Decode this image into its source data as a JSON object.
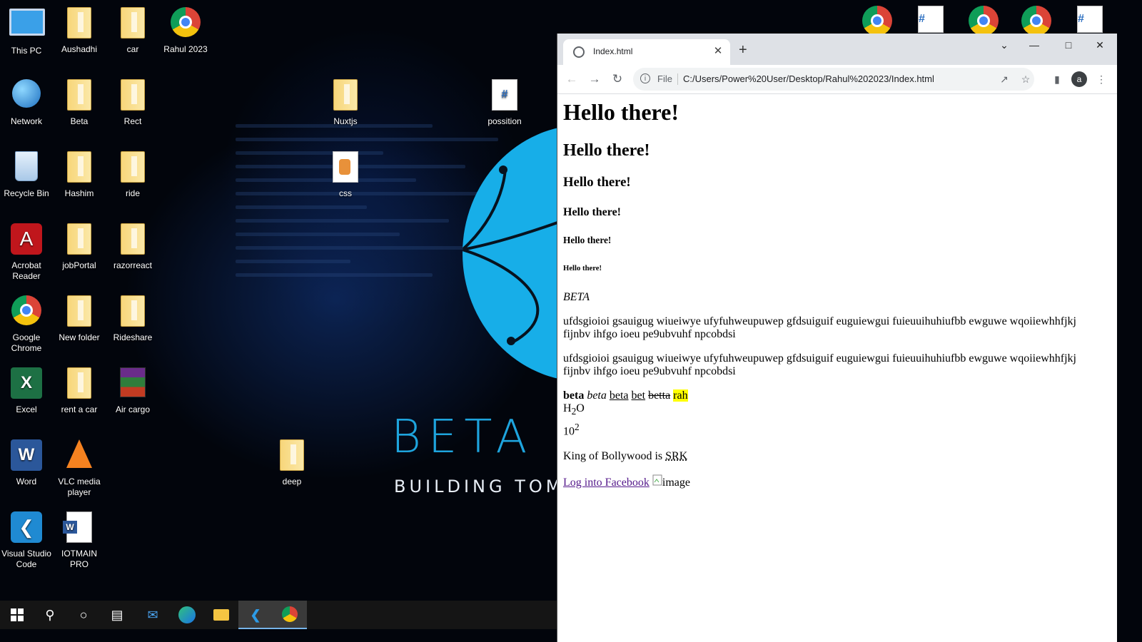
{
  "desktop": {
    "icons": [
      {
        "label": "This PC"
      },
      {
        "label": "Aushadhi"
      },
      {
        "label": "car"
      },
      {
        "label": "Rahul 2023"
      },
      {
        "label": "Network"
      },
      {
        "label": "Beta"
      },
      {
        "label": "Rect"
      },
      {
        "label": "Nuxtjs"
      },
      {
        "label": "possition"
      },
      {
        "label": "Recycle Bin"
      },
      {
        "label": "Hashim"
      },
      {
        "label": "ride"
      },
      {
        "label": "css"
      },
      {
        "label": "Acrobat Reader"
      },
      {
        "label": "jobPortal"
      },
      {
        "label": "razorreact"
      },
      {
        "label": "Google Chrome"
      },
      {
        "label": "New folder"
      },
      {
        "label": "Rideshare"
      },
      {
        "label": "Excel"
      },
      {
        "label": "rent a car"
      },
      {
        "label": "Air cargo"
      },
      {
        "label": "Word"
      },
      {
        "label": "VLC media player"
      },
      {
        "label": "deep"
      },
      {
        "label": "Visual Studio Code"
      },
      {
        "label": "IOTMAIN PRO"
      }
    ],
    "wallpaper": {
      "headline": "BETA IN",
      "tagline": "BUILDING TOMORROV"
    }
  },
  "taskbar": {
    "items": [
      "windows-start",
      "search",
      "cortana",
      "task-view",
      "mail",
      "edge",
      "file-explorer",
      "vscode",
      "chrome"
    ]
  },
  "browser": {
    "tab_title": "Index.html",
    "omnibox": {
      "scheme_label": "File",
      "url": "C:/Users/Power%20User/Desktop/Rahul%202023/Index.html"
    },
    "avatar_letter": "a"
  },
  "page": {
    "h1": "Hello there!",
    "h2": "Hello there!",
    "h3": "Hello there!",
    "h4": "Hello there!",
    "h5": "Hello there!",
    "h6": "Hello there!",
    "italic_heading": "BETA",
    "para1": "ufdsgioioi gsauigug wiueiwye ufyfuhweupuwep gfdsuiguif euguiewgui fuieuuihuhiufbb ewguwe wqoiiewhhfjkj fijnbv ihfgo ioeu pe9ubvuhf npcobdsi",
    "para2": "ufdsgioioi gsauigug wiueiwye ufyfuhweupuwep gfdsuiguif euguiewgui fuieuuihuhiufbb ewguwe wqoiiewhhfjkj fijnbv ihfgo ioeu pe9ubvuhf npcobdsi",
    "formatting": {
      "bold": "beta",
      "italic": "beta",
      "underline": "beta",
      "ins": "bet",
      "strike": "betta",
      "mark": "rah"
    },
    "chem": {
      "h": "H",
      "sub": "2",
      "o": "O"
    },
    "power": {
      "base": "10",
      "sup": "2"
    },
    "abbr_sentence": "King of Bollywood is ",
    "abbr": "SRK",
    "link": "Log into Facebook",
    "img_alt": "image"
  }
}
